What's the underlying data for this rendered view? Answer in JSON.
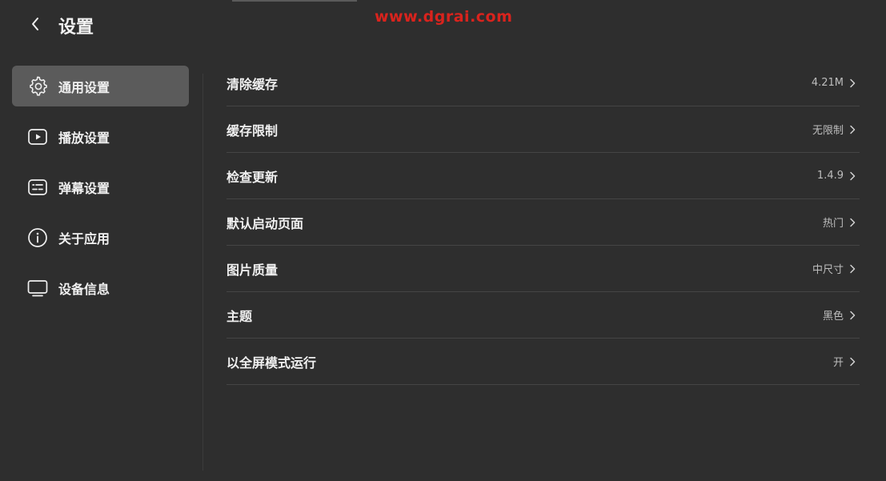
{
  "header": {
    "title": "设置",
    "back_icon": "chevron-left-icon"
  },
  "watermark": "www.dgrai.com",
  "sidebar": {
    "items": [
      {
        "label": "通用设置",
        "icon": "gear-icon",
        "active": true
      },
      {
        "label": "播放设置",
        "icon": "play-icon",
        "active": false
      },
      {
        "label": "弹幕设置",
        "icon": "danmaku-icon",
        "active": false
      },
      {
        "label": "关于应用",
        "icon": "info-icon",
        "active": false
      },
      {
        "label": "设备信息",
        "icon": "monitor-icon",
        "active": false
      }
    ]
  },
  "settings": {
    "rows": [
      {
        "label": "清除缓存",
        "value": "4.21M"
      },
      {
        "label": "缓存限制",
        "value": "无限制"
      },
      {
        "label": "检查更新",
        "value": "1.4.9"
      },
      {
        "label": "默认启动页面",
        "value": "热门"
      },
      {
        "label": "图片质量",
        "value": "中尺寸"
      },
      {
        "label": "主题",
        "value": "黑色"
      },
      {
        "label": "以全屏模式运行",
        "value": "开"
      }
    ]
  },
  "colors": {
    "background": "#2e2e2e",
    "active_item": "#5b5b5b",
    "divider": "#454545",
    "watermark": "#d9231d"
  }
}
